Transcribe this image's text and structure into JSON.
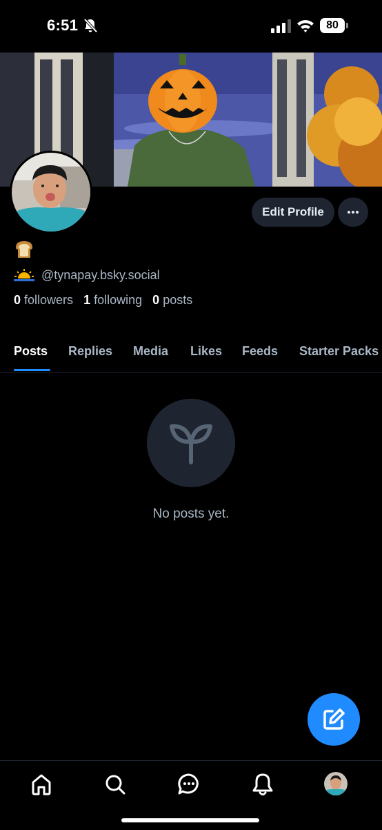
{
  "status_bar": {
    "time": "6:51",
    "battery": "80",
    "icons": [
      "bell-slash-icon",
      "cellular-signal-icon",
      "wifi-icon",
      "battery-icon"
    ]
  },
  "profile": {
    "bio_emoji": "bread-emoji",
    "handle_emoji": "sunrise-emoji",
    "handle": "@tynapay.bsky.social",
    "edit_button": "Edit Profile",
    "more_button_icon": "ellipsis-icon",
    "stats": {
      "followers_count": "0",
      "followers_label": "followers",
      "following_count": "1",
      "following_label": "following",
      "posts_count": "0",
      "posts_label": "posts"
    }
  },
  "tabs": [
    {
      "label": "Posts",
      "active": true
    },
    {
      "label": "Replies",
      "active": false
    },
    {
      "label": "Media",
      "active": false
    },
    {
      "label": "Likes",
      "active": false
    },
    {
      "label": "Feeds",
      "active": false
    },
    {
      "label": "Starter Packs",
      "active": false
    }
  ],
  "empty_state": {
    "icon": "seedling-icon",
    "message": "No posts yet."
  },
  "fab": {
    "icon": "compose-icon"
  },
  "bottom_nav": [
    {
      "icon": "home-icon"
    },
    {
      "icon": "search-icon"
    },
    {
      "icon": "chat-icon"
    },
    {
      "icon": "bell-icon"
    },
    {
      "icon": "profile-avatar"
    }
  ],
  "colors": {
    "background": "#000000",
    "accent": "#208bfe",
    "muted_text": "#aab7c6",
    "button_bg": "#1e2530"
  }
}
